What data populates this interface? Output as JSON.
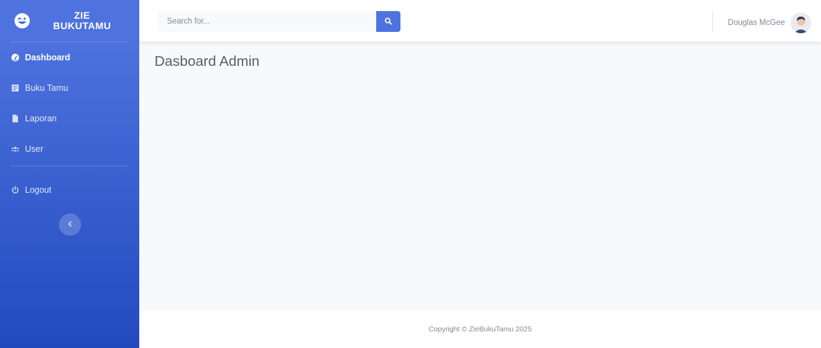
{
  "brand": {
    "line1": "ZIE",
    "line2": "BUKUTAMU"
  },
  "sidebar": {
    "items": [
      {
        "label": "Dashboard",
        "icon": "tachometer-icon"
      },
      {
        "label": "Buku Tamu",
        "icon": "book-icon"
      },
      {
        "label": "Laporan",
        "icon": "file-icon"
      },
      {
        "label": "User",
        "icon": "users-icon"
      }
    ],
    "logout": {
      "label": "Logout",
      "icon": "power-icon"
    },
    "toggle_icon": "chevron-left-icon"
  },
  "topbar": {
    "search": {
      "placeholder": "Search for...",
      "value": ""
    },
    "user_name": "Douglas McGee"
  },
  "main": {
    "title": "Dasboard Admin"
  },
  "footer": {
    "copyright": "Copyright © ZieBukuTamu 2025"
  },
  "colors": {
    "sidebar_top": "#4e73df",
    "sidebar_bottom": "#224abe",
    "accent": "#4e73df",
    "page_bg": "#f8f9fc",
    "text_muted": "#858796",
    "title": "#5a5c69"
  }
}
